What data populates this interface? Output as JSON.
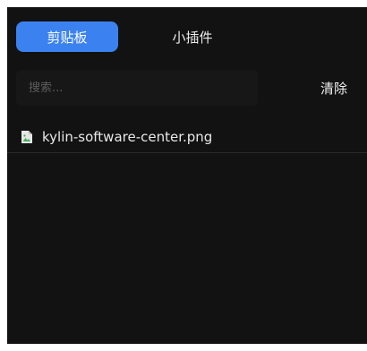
{
  "tabs": [
    {
      "label": "剪贴板",
      "active": true
    },
    {
      "label": "小插件",
      "active": false
    }
  ],
  "search": {
    "placeholder": "搜索...",
    "value": ""
  },
  "clear_label": "清除",
  "items": [
    {
      "name": "kylin-software-center.png",
      "icon": "image-file-icon"
    }
  ],
  "colors": {
    "background": "#121212",
    "accent": "#3b82f0",
    "text": "#e8e8e8"
  }
}
